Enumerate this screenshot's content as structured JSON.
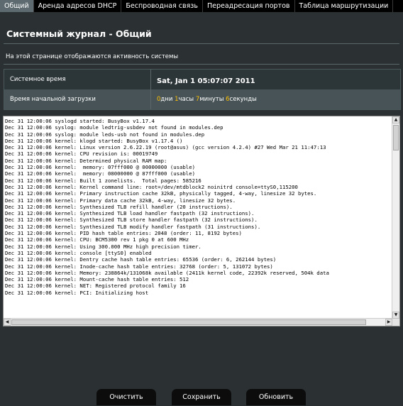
{
  "tabs": [
    "Общий",
    "Аренда адресов DHCP",
    "Беспроводная связь",
    "Переадресация портов",
    "Таблица маршрутизации"
  ],
  "page": {
    "title": "Системный журнал - Общий",
    "description": "На этой странице отображаются активность системы"
  },
  "info": {
    "system_time_label": "Системное время",
    "system_time_value": "Sat, Jan 1  05:07:07  2011",
    "uptime_label": "Время начальной загрузки",
    "uptime": {
      "days": "0",
      "days_unit": "дни",
      "hours": "1",
      "hours_unit": "часы",
      "minutes": "7",
      "minutes_unit": "минуты",
      "seconds": "6",
      "seconds_unit": "секунды"
    }
  },
  "log_lines": [
    "Dec 31 12:00:06 syslogd started: BusyBox v1.17.4",
    "Dec 31 12:00:06 syslog: module ledtrig-usbdev not found in modules.dep",
    "Dec 31 12:00:06 syslog: module leds-usb not found in modules.dep",
    "Dec 31 12:00:06 kernel: klogd started: BusyBox v1.17.4 ()",
    "Dec 31 12:00:06 kernel: Linux version 2.6.22.19 (root@asus) (gcc version 4.2.4) #27 Wed Mar 21 11:47:13",
    "Dec 31 12:00:06 kernel: CPU revision is: 00019749",
    "Dec 31 12:00:06 kernel: Determined physical RAM map:",
    "Dec 31 12:00:06 kernel:  memory: 07fff000 @ 00000000 (usable)",
    "Dec 31 12:00:06 kernel:  memory: 08000000 @ 87fff000 (usable)",
    "Dec 31 12:00:06 kernel: Built 1 zonelists.  Total pages: 585216",
    "Dec 31 12:00:06 kernel: Kernel command line: root=/dev/mtdblock2 noinitrd console=ttyS0,115200",
    "Dec 31 12:00:06 kernel: Primary instruction cache 32kB, physically tagged, 4-way, linesize 32 bytes.",
    "Dec 31 12:00:06 kernel: Primary data cache 32kB, 4-way, linesize 32 bytes.",
    "Dec 31 12:00:06 kernel: Synthesized TLB refill handler (20 instructions).",
    "Dec 31 12:00:06 kernel: Synthesized TLB load handler fastpath (32 instructions).",
    "Dec 31 12:00:06 kernel: Synthesized TLB store handler fastpath (32 instructions).",
    "Dec 31 12:00:06 kernel: Synthesized TLB modify handler fastpath (31 instructions).",
    "Dec 31 12:00:06 kernel: PID hash table entries: 2048 (order: 11, 8192 bytes)",
    "Dec 31 12:00:06 kernel: CPU: BCM5300 rev 1 pkg 0 at 600 MHz",
    "Dec 31 12:00:06 kernel: Using 300.000 MHz high precision timer.",
    "Dec 31 12:00:06 kernel: console [ttyS0] enabled",
    "Dec 31 12:00:06 kernel: Dentry cache hash table entries: 65536 (order: 6, 262144 bytes)",
    "Dec 31 12:00:06 kernel: Inode-cache hash table entries: 32768 (order: 5, 131072 bytes)",
    "Dec 31 12:00:06 kernel: Memory: 238864k/131068k available (2411k kernel code, 22392k reserved, 504k data",
    "Dec 31 12:00:06 kernel: Mount-cache hash table entries: 512",
    "Dec 31 12:00:06 kernel: NET: Registered protocol family 16",
    "Dec 31 12:00:06 kernel: PCI: Initializing host"
  ],
  "buttons": {
    "clear": "Очистить",
    "save": "Сохранить",
    "refresh": "Обновить"
  },
  "colors": {
    "background": "#2b3033",
    "tab_active": "#5d6b70",
    "accent_number": "#ffc000"
  },
  "icons": {
    "scroll_up": "▲",
    "scroll_down": "▼",
    "scroll_left": "◀",
    "scroll_right": "▶"
  }
}
